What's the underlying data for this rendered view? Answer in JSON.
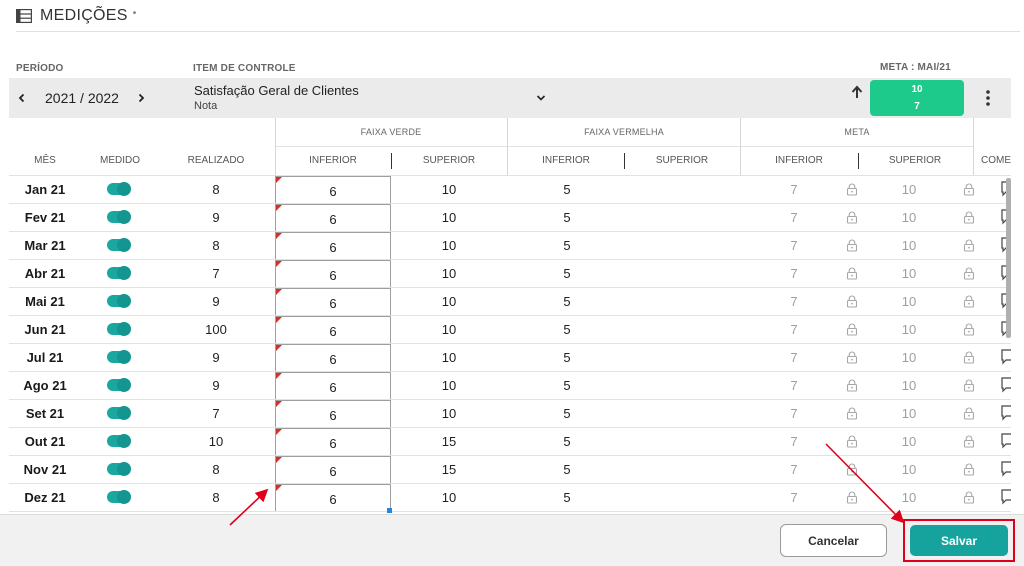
{
  "page": {
    "title": "MEDIÇÕES",
    "title_marker": "•"
  },
  "labels": {
    "periodo": "PERÍODO",
    "item_controle": "ITEM DE CONTROLE",
    "meta_periodo": "META : MAI/21"
  },
  "control": {
    "period": "2021 / 2022",
    "item_name": "Satisfação Geral de Clientes",
    "item_unit": "Nota",
    "meta_superior": "10",
    "meta_inferior": "7",
    "direction": "arrow-up-icon"
  },
  "table": {
    "groups": {
      "faixa_verde": "FAIXA VERDE",
      "faixa_vermelha": "FAIXA VERMELHA",
      "meta": "META"
    },
    "columns": {
      "mes": "MÊS",
      "medido": "MEDIDO",
      "realizado": "REALIZADO",
      "verde_inferior": "INFERIOR",
      "verde_superior": "SUPERIOR",
      "vermelha_inferior": "INFERIOR",
      "vermelha_superior": "SUPERIOR",
      "meta_inferior": "INFERIOR",
      "meta_superior": "SUPERIOR",
      "comentario": "COMEN"
    },
    "rows": [
      {
        "mes": "Jan 21",
        "medido": true,
        "realizado": "8",
        "verde_inferior": "6",
        "verde_superior": "10",
        "vermelha_inferior": "5",
        "meta_inferior": "7",
        "meta_superior": "10"
      },
      {
        "mes": "Fev 21",
        "medido": true,
        "realizado": "9",
        "verde_inferior": "6",
        "verde_superior": "10",
        "vermelha_inferior": "5",
        "meta_inferior": "7",
        "meta_superior": "10"
      },
      {
        "mes": "Mar 21",
        "medido": true,
        "realizado": "8",
        "verde_inferior": "6",
        "verde_superior": "10",
        "vermelha_inferior": "5",
        "meta_inferior": "7",
        "meta_superior": "10"
      },
      {
        "mes": "Abr 21",
        "medido": true,
        "realizado": "7",
        "verde_inferior": "6",
        "verde_superior": "10",
        "vermelha_inferior": "5",
        "meta_inferior": "7",
        "meta_superior": "10"
      },
      {
        "mes": "Mai 21",
        "medido": true,
        "realizado": "9",
        "verde_inferior": "6",
        "verde_superior": "10",
        "vermelha_inferior": "5",
        "meta_inferior": "7",
        "meta_superior": "10"
      },
      {
        "mes": "Jun 21",
        "medido": true,
        "realizado": "100",
        "verde_inferior": "6",
        "verde_superior": "10",
        "vermelha_inferior": "5",
        "meta_inferior": "7",
        "meta_superior": "10"
      },
      {
        "mes": "Jul 21",
        "medido": true,
        "realizado": "9",
        "verde_inferior": "6",
        "verde_superior": "10",
        "vermelha_inferior": "5",
        "meta_inferior": "7",
        "meta_superior": "10"
      },
      {
        "mes": "Ago 21",
        "medido": true,
        "realizado": "9",
        "verde_inferior": "6",
        "verde_superior": "10",
        "vermelha_inferior": "5",
        "meta_inferior": "7",
        "meta_superior": "10"
      },
      {
        "mes": "Set 21",
        "medido": true,
        "realizado": "7",
        "verde_inferior": "6",
        "verde_superior": "10",
        "vermelha_inferior": "5",
        "meta_inferior": "7",
        "meta_superior": "10"
      },
      {
        "mes": "Out 21",
        "medido": true,
        "realizado": "10",
        "verde_inferior": "6",
        "verde_superior": "15",
        "vermelha_inferior": "5",
        "meta_inferior": "7",
        "meta_superior": "10"
      },
      {
        "mes": "Nov 21",
        "medido": true,
        "realizado": "8",
        "verde_inferior": "6",
        "verde_superior": "15",
        "vermelha_inferior": "5",
        "meta_inferior": "7",
        "meta_superior": "10"
      },
      {
        "mes": "Dez 21",
        "medido": true,
        "realizado": "8",
        "verde_inferior": "6",
        "verde_superior": "10",
        "vermelha_inferior": "5",
        "meta_inferior": "7",
        "meta_superior": "10"
      }
    ]
  },
  "footer": {
    "cancel_label": "Cancelar",
    "save_label": "Salvar"
  },
  "colors": {
    "meta_badge": "#1ec98c",
    "toggle_on": "#1aa7a0",
    "save_button": "#16a39d",
    "annotation": "#e0001b"
  }
}
